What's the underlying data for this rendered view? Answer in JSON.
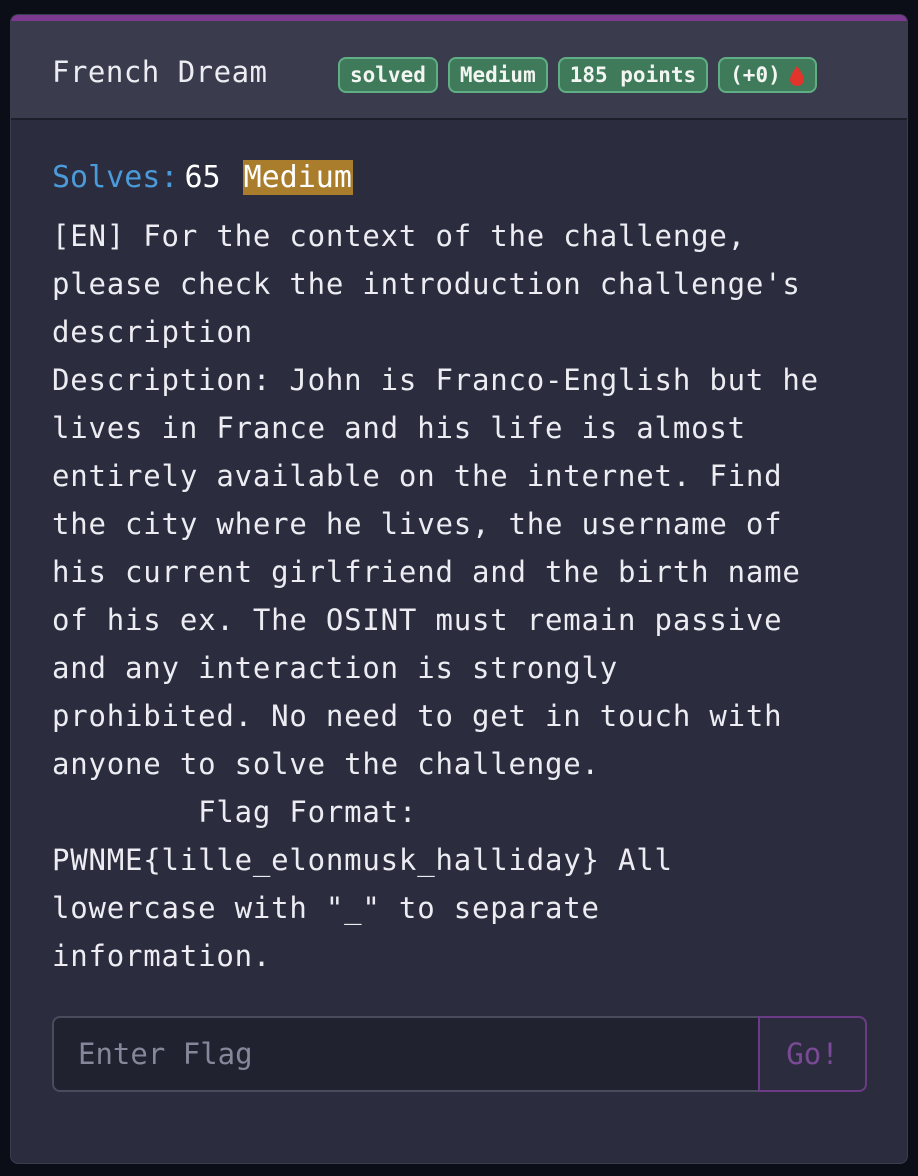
{
  "challenge": {
    "title": "French Dream",
    "badges": {
      "status": "solved",
      "difficulty": "Medium",
      "points": "185 points",
      "bonus": "(+0)"
    },
    "solves_label": "Solves:",
    "solves_count": "65",
    "difficulty_tag": "Medium",
    "description": "[EN] For the context of the challenge,\nplease check the introduction challenge's\ndescription\nDescription: John is Franco-English but he\nlives in France and his life is almost\nentirely available on the internet. Find\nthe city where he lives, the username of\nhis current girlfriend and the birth name\nof his ex. The OSINT must remain passive\nand any interaction is strongly\nprohibited. No need to get in touch with\nanyone to solve the challenge.\n        Flag Format:\nPWNME{lille_elonmusk_halliday} All\nlowercase with \"_\" to separate\ninformation."
  },
  "flag_form": {
    "placeholder": "Enter Flag",
    "value": "",
    "submit_label": "Go!"
  },
  "icons": {
    "first_blood": "blood-drop-icon"
  },
  "colors": {
    "accent_bar": "#7b3a8f",
    "badge_green": "#3f7a5a",
    "difficulty_medium": "#a97d2c",
    "solves_label": "#4b9ad9",
    "drop_red": "#e0342c"
  }
}
